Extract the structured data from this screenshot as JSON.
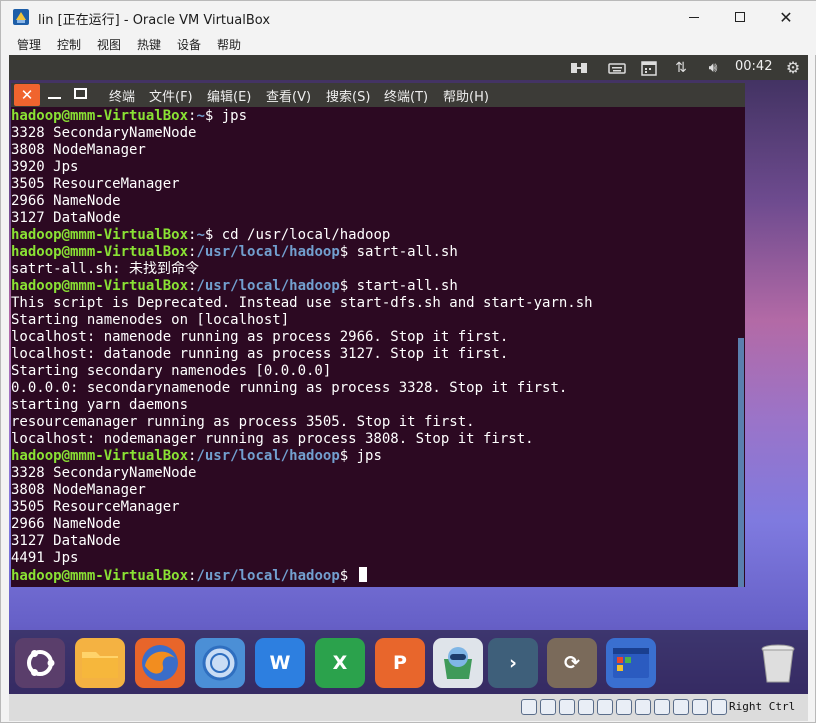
{
  "window": {
    "title": "lin [正在运行] - Oracle VM VirtualBox",
    "menu": [
      "管理",
      "控制",
      "视图",
      "热键",
      "设备",
      "帮助"
    ]
  },
  "guest_topbar": {
    "clock": "00:42",
    "icons": [
      "transfer-icon",
      "keyboard-icon",
      "calendar-icon",
      "network-arrows-icon",
      "volume-icon",
      "settings-gear-icon"
    ]
  },
  "terminal": {
    "menu": [
      "终端",
      "文件(F)",
      "编辑(E)",
      "查看(V)",
      "搜索(S)",
      "终端(T)",
      "帮助(H)"
    ],
    "lines": [
      {
        "user": "hadoop@mmm-VirtualBox",
        "path": "~",
        "cmd": "jps"
      },
      {
        "text": "3328 SecondaryNameNode"
      },
      {
        "text": "3808 NodeManager"
      },
      {
        "text": "3920 Jps"
      },
      {
        "text": "3505 ResourceManager"
      },
      {
        "text": "2966 NameNode"
      },
      {
        "text": "3127 DataNode"
      },
      {
        "user": "hadoop@mmm-VirtualBox",
        "path": "~",
        "cmd": "cd /usr/local/hadoop"
      },
      {
        "user": "hadoop@mmm-VirtualBox",
        "path": "/usr/local/hadoop",
        "cmd": "satrt-all.sh"
      },
      {
        "text": "satrt-all.sh: 未找到命令"
      },
      {
        "user": "hadoop@mmm-VirtualBox",
        "path": "/usr/local/hadoop",
        "cmd": "start-all.sh"
      },
      {
        "text": "This script is Deprecated. Instead use start-dfs.sh and start-yarn.sh"
      },
      {
        "text": "Starting namenodes on [localhost]"
      },
      {
        "text": "localhost: namenode running as process 2966. Stop it first."
      },
      {
        "text": "localhost: datanode running as process 3127. Stop it first."
      },
      {
        "text": "Starting secondary namenodes [0.0.0.0]"
      },
      {
        "text": "0.0.0.0: secondarynamenode running as process 3328. Stop it first."
      },
      {
        "text": "starting yarn daemons"
      },
      {
        "text": "resourcemanager running as process 3505. Stop it first."
      },
      {
        "text": "localhost: nodemanager running as process 3808. Stop it first."
      },
      {
        "user": "hadoop@mmm-VirtualBox",
        "path": "/usr/local/hadoop",
        "cmd": "jps"
      },
      {
        "text": "3328 SecondaryNameNode"
      },
      {
        "text": "3808 NodeManager"
      },
      {
        "text": "3505 ResourceManager"
      },
      {
        "text": "2966 NameNode"
      },
      {
        "text": "3127 DataNode"
      },
      {
        "text": "4491 Jps"
      },
      {
        "user": "hadoop@mmm-VirtualBox",
        "path": "/usr/local/hadoop",
        "cmd": "",
        "cursor": true
      }
    ]
  },
  "dock": {
    "items": [
      {
        "name": "ubuntu-dash-icon",
        "glyph": "◉",
        "bg": "#5a3e6b"
      },
      {
        "name": "files-folder-icon",
        "glyph": "",
        "bg": "#f4b242"
      },
      {
        "name": "firefox-icon",
        "glyph": "",
        "bg": "#e8652a"
      },
      {
        "name": "browser-globe-icon",
        "glyph": "",
        "bg": "#4b8fd6"
      },
      {
        "name": "wps-writer-icon",
        "glyph": "W",
        "bg": "#2d7fe0"
      },
      {
        "name": "wps-spreadsheet-icon",
        "glyph": "X",
        "bg": "#2ba24c"
      },
      {
        "name": "wps-presentation-icon",
        "glyph": "P",
        "bg": "#e8662c"
      },
      {
        "name": "software-center-icon",
        "glyph": "",
        "bg": "#dfe4ea"
      },
      {
        "name": "terminal-app-icon",
        "glyph": "›",
        "bg": "#3e5f7a"
      },
      {
        "name": "update-manager-icon",
        "glyph": "⟳",
        "bg": "#7a6a5a"
      },
      {
        "name": "workspace-switcher-icon",
        "glyph": "",
        "bg": "#3a6fd0"
      },
      {
        "name": "trash-icon",
        "glyph": "",
        "bg": "transparent"
      }
    ]
  },
  "statusbar": {
    "host_key": "Right Ctrl"
  }
}
